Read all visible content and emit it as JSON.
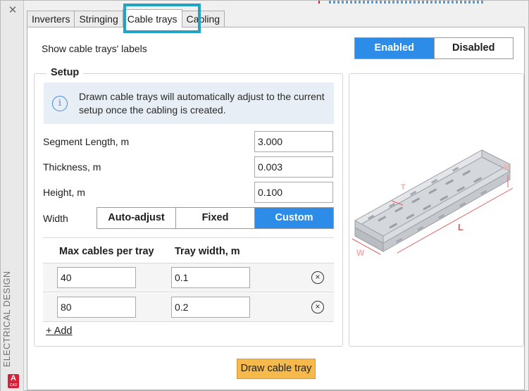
{
  "window": {
    "side_label": "ELECTRICAL DESIGN",
    "close_glyph": "✕",
    "app_badge": "A",
    "app_badge_sub": "CAD"
  },
  "tabs": [
    {
      "label": "Inverters",
      "active": false
    },
    {
      "label": "Stringing",
      "active": false
    },
    {
      "label": "Cable trays",
      "active": true
    },
    {
      "label": "Cabling",
      "active": false
    }
  ],
  "labels_toggle": {
    "label": "Show cable trays' labels",
    "enabled_label": "Enabled",
    "disabled_label": "Disabled",
    "selected": "Enabled"
  },
  "setup": {
    "title": "Setup",
    "info_icon": "i",
    "info_text": "Drawn cable trays will automatically adjust to the current setup once the cabling is created.",
    "segment_length": {
      "label": "Segment Length, m",
      "value": "3.000"
    },
    "thickness": {
      "label": "Thickness, m",
      "value": "0.003"
    },
    "height": {
      "label": "Height, m",
      "value": "0.100"
    },
    "width": {
      "label": "Width",
      "options": [
        "Auto-adjust",
        "Fixed",
        "Custom"
      ],
      "selected": "Custom"
    },
    "table": {
      "headers": [
        "Max cables per tray",
        "Tray width, m"
      ],
      "rows": [
        {
          "max_cables": "40",
          "tray_width": "0.1"
        },
        {
          "max_cables": "80",
          "tray_width": "0.2"
        }
      ],
      "remove_glyph": "×"
    },
    "add_label": "+ Add"
  },
  "illustration": {
    "dims": {
      "height": "H",
      "thickness": "T",
      "length": "L",
      "width": "W"
    },
    "accent_color": "#e06060"
  },
  "draw_button": "Draw cable tray",
  "colors": {
    "accent_blue": "#2d8ce8",
    "tab_highlight": "#21a3c4",
    "draw_button": "#f5b94c"
  }
}
